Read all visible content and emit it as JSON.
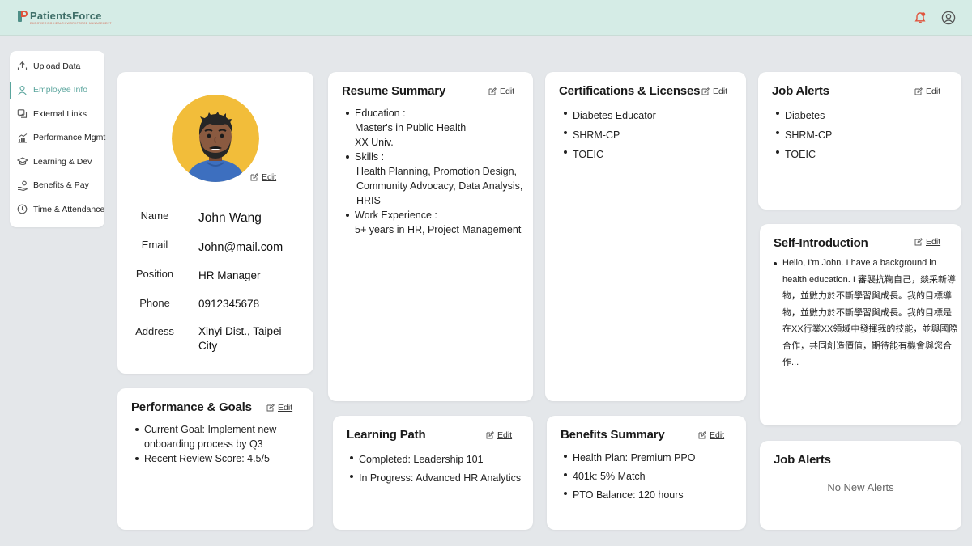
{
  "app": {
    "name": "PatientsForce",
    "tagline": "EMPOWERING HEALTH WORKFORCE MANAGEMENT"
  },
  "colors": {
    "accent": "#5aa59d",
    "header_bg": "#d5ece6",
    "notification": "#e0533c"
  },
  "header": {
    "icons": [
      "bell-icon",
      "user-circle-icon"
    ]
  },
  "sidebar": {
    "items": [
      {
        "label": "Upload Data",
        "icon": "upload-icon"
      },
      {
        "label": "Employee Info",
        "icon": "person-icon",
        "active": true
      },
      {
        "label": "External Links",
        "icon": "link-icon"
      },
      {
        "label": "Performance Mgmt",
        "icon": "chart-icon"
      },
      {
        "label": "Learning & Dev",
        "icon": "graduation-cap-icon"
      },
      {
        "label": "Benefits & Pay",
        "icon": "hand-coin-icon"
      },
      {
        "label": "Time & Attendance",
        "icon": "clock-icon"
      }
    ]
  },
  "edit_label": "Edit",
  "profile": {
    "fields": [
      {
        "label": "Name",
        "value": "John Wang"
      },
      {
        "label": "Email",
        "value": "John@mail.com"
      },
      {
        "label": "Position",
        "value": "HR Manager"
      },
      {
        "label": "Phone",
        "value": "0912345678"
      },
      {
        "label": "Address",
        "value": "Xinyi Dist., Taipei City"
      }
    ]
  },
  "resume": {
    "title": "Resume Summary",
    "education_label": "Education :",
    "education": [
      "Master's in Public Health",
      "XX Univ."
    ],
    "skills_label": "Skills :",
    "skills": "Health Planning, Promotion Design, Community Advocacy, Data Analysis, HRIS",
    "work_label": "Work Experience :",
    "work": "5+ years in HR, Project Management"
  },
  "certifications": {
    "title": "Certifications & Licenses",
    "items": [
      "Diabetes Educator",
      "SHRM-CP",
      "TOEIC"
    ]
  },
  "job_alerts": {
    "title": "Job Alerts",
    "items": [
      "Diabetes",
      "SHRM-CP",
      "TOEIC"
    ]
  },
  "self_intro": {
    "title": "Self-Introduction",
    "text": "Hello, I'm John. I have a background in health education. I 審襲抗鞠自己，燚采新導物，並數力於不斷學習與成長。我的目標導物，並數力於不斷學習與成長。我的目標是在XX行業XX領域中發揮我的技能，並與國際合作，共同創造價值，期待能有機會與您合作..."
  },
  "performance": {
    "title": "Performance & Goals",
    "items": [
      "Current Goal: Implement new onboarding process by Q3",
      "Recent Review Score: 4.5/5"
    ]
  },
  "learning": {
    "title": "Learning Path",
    "items": [
      "Completed: Leadership 101",
      "In Progress: Advanced HR Analytics"
    ]
  },
  "benefits": {
    "title": "Benefits Summary",
    "items": [
      "Health Plan: Premium PPO",
      "401k: 5% Match",
      "PTO Balance: 120 hours"
    ]
  },
  "job_alerts_2": {
    "title": "Job Alerts",
    "empty": "No New Alerts"
  }
}
